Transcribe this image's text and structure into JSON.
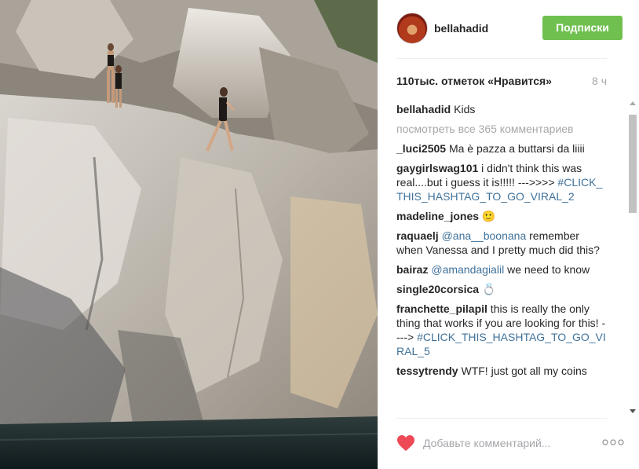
{
  "post": {
    "username": "bellahadid",
    "follow_label": "Подписки",
    "likes": "110тыс. отметок «Нравится»",
    "time": "8 ч",
    "caption": {
      "user": "bellahadid",
      "text": " Kids"
    },
    "view_all": "посмотреть все 365 комментариев",
    "comments": [
      {
        "user": "_luci2505",
        "parts": [
          {
            "type": "text",
            "text": " Ma è pazza a buttarsi da liiii"
          }
        ]
      },
      {
        "user": "gaygirlswag101",
        "parts": [
          {
            "type": "text",
            "text": " i didn't think this was real....but i guess it is!!!!! --->>>> "
          },
          {
            "type": "hashtag",
            "text": "#CLICK_THIS_HASHTAG_TO_GO_VIRAL_2"
          }
        ]
      },
      {
        "user": "madeline_jones",
        "parts": [
          {
            "type": "text",
            "text": " 🙂"
          }
        ]
      },
      {
        "user": "raquaelj",
        "parts": [
          {
            "type": "text",
            "text": " "
          },
          {
            "type": "mention",
            "text": "@ana__boonana"
          },
          {
            "type": "text",
            "text": " remember when Vanessa and I pretty much did this?"
          }
        ]
      },
      {
        "user": "bairaz",
        "parts": [
          {
            "type": "text",
            "text": " "
          },
          {
            "type": "mention",
            "text": "@amandagialil"
          },
          {
            "type": "text",
            "text": " we need to know"
          }
        ]
      },
      {
        "user": "single20corsica",
        "parts": [
          {
            "type": "text",
            "text": " 💍"
          }
        ]
      },
      {
        "user": "franchette_pilapil",
        "parts": [
          {
            "type": "text",
            "text": " this is really the only thing that works if you are looking for this! ----> "
          },
          {
            "type": "hashtag",
            "text": "#CLICK_THIS_HASHTAG_TO_GO_VIRAL_5"
          }
        ]
      },
      {
        "user": "tessytrendy",
        "parts": [
          {
            "type": "text",
            "text": " WTF! just got all my coins"
          }
        ]
      }
    ],
    "comment_placeholder": "Добавьте комментарий...",
    "icons": {
      "like": "heart-icon",
      "more": "more-options-icon",
      "avatar": "avatar"
    },
    "colors": {
      "follow": "#70c050",
      "heart": "#ed4956",
      "link": "#3f729b"
    }
  }
}
